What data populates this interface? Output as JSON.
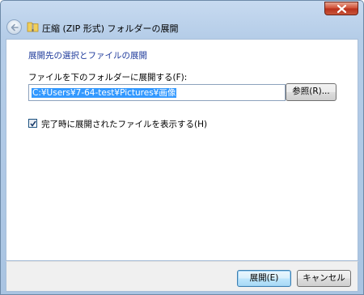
{
  "dialog": {
    "title": "圧縮 (ZIP 形式) フォルダーの展開",
    "heading": "展開先の選択とファイルの展開",
    "field_label": "ファイルを下のフォルダーに展開する(F):",
    "path_value": "C:¥Users¥7-64-test¥Pictures¥画像",
    "browse_label": "参照(R)...",
    "show_files_label": "完了時に展開されたファイルを表示する(H)",
    "show_files_checked": true,
    "extract_label": "展開(E)",
    "cancel_label": "キャンセル"
  },
  "colors": {
    "heading": "#1e3a9b",
    "selection": "#3399ff",
    "close_button": "#c8553a"
  },
  "icons": [
    "back-arrow-icon",
    "zip-folder-icon",
    "close-icon",
    "checkmark-icon"
  ]
}
